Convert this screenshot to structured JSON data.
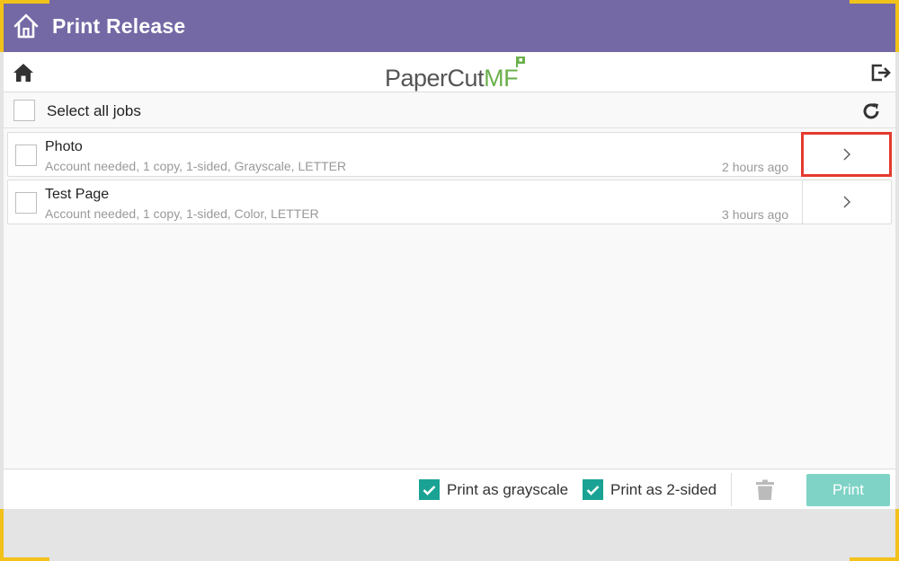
{
  "window": {
    "title": "Print Release"
  },
  "header": {
    "logo_main": "PaperCut",
    "logo_suffix": "MF"
  },
  "select_all": {
    "label": "Select all jobs"
  },
  "jobs": [
    {
      "name": "Photo",
      "details": "Account needed, 1 copy, 1-sided, Grayscale, LETTER",
      "time": "2 hours ago",
      "detail_icon": "chevron-right-icon"
    },
    {
      "name": "Test Page",
      "details": "Account needed, 1 copy, 1-sided, Color, LETTER",
      "time": "3 hours ago",
      "detail_icon": "chevron-right-icon"
    }
  ],
  "footer": {
    "grayscale_label": "Print as grayscale",
    "grayscale_checked": true,
    "two_sided_label": "Print as 2-sided",
    "two_sided_checked": true,
    "print_label": "Print"
  },
  "colors": {
    "title_bar": "#7469a5",
    "accent": "#1aa394",
    "print_button": "#7fd3c6",
    "corner": "#f2c21b",
    "highlight": "#e53a2f",
    "logo_green": "#6ab04c"
  }
}
